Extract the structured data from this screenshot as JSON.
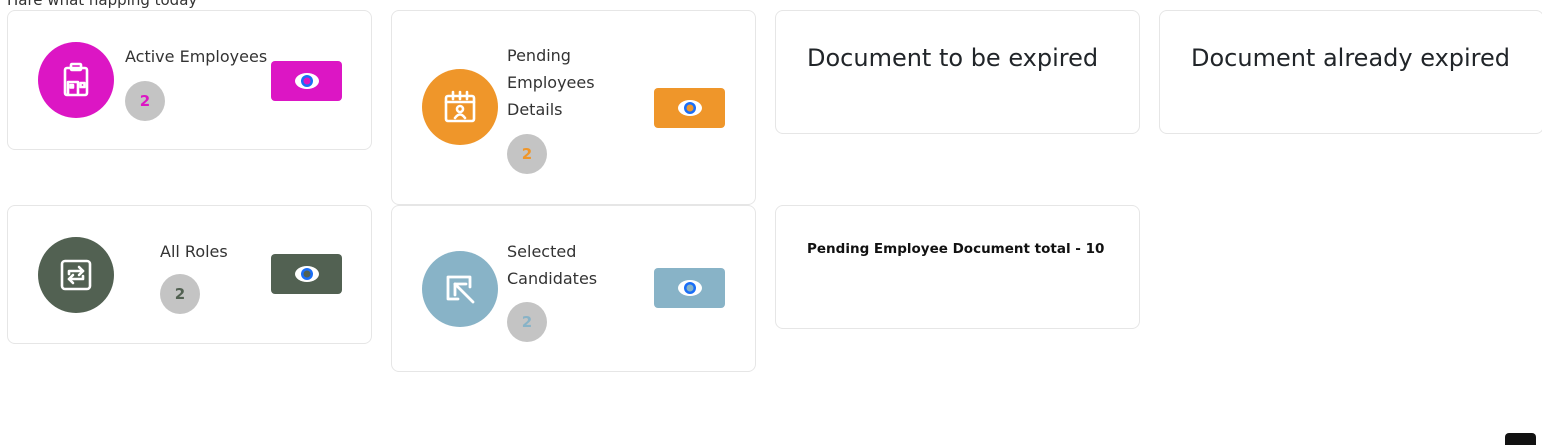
{
  "header": {
    "subtitle": "Hare what happing today"
  },
  "cards": {
    "active_employees": {
      "label": "Active Employees",
      "count": "2",
      "color": "#dc16c4",
      "icon": "clipboard-building-icon"
    },
    "pending_details": {
      "label_lines": [
        "Pending",
        "Employees",
        "Details"
      ],
      "count": "2",
      "color": "#ef962a",
      "icon": "calendar-user-icon"
    },
    "all_roles": {
      "label": "All Roles",
      "count": "2",
      "color": "#526152",
      "icon": "repeat-icon"
    },
    "selected_candidates": {
      "label_lines": [
        "Selected",
        "Candidates"
      ],
      "count": "2",
      "color": "#88b3c7",
      "icon": "cursor-arrow-icon"
    }
  },
  "documents": {
    "to_be_expired": "Document to be expired",
    "already_expired": "Document already expired",
    "pending_total": "Pending Employee Document  total - 10"
  },
  "colors": {
    "eye_blue": "#1a6ef7",
    "badge_gray": "#c4c4c4"
  }
}
